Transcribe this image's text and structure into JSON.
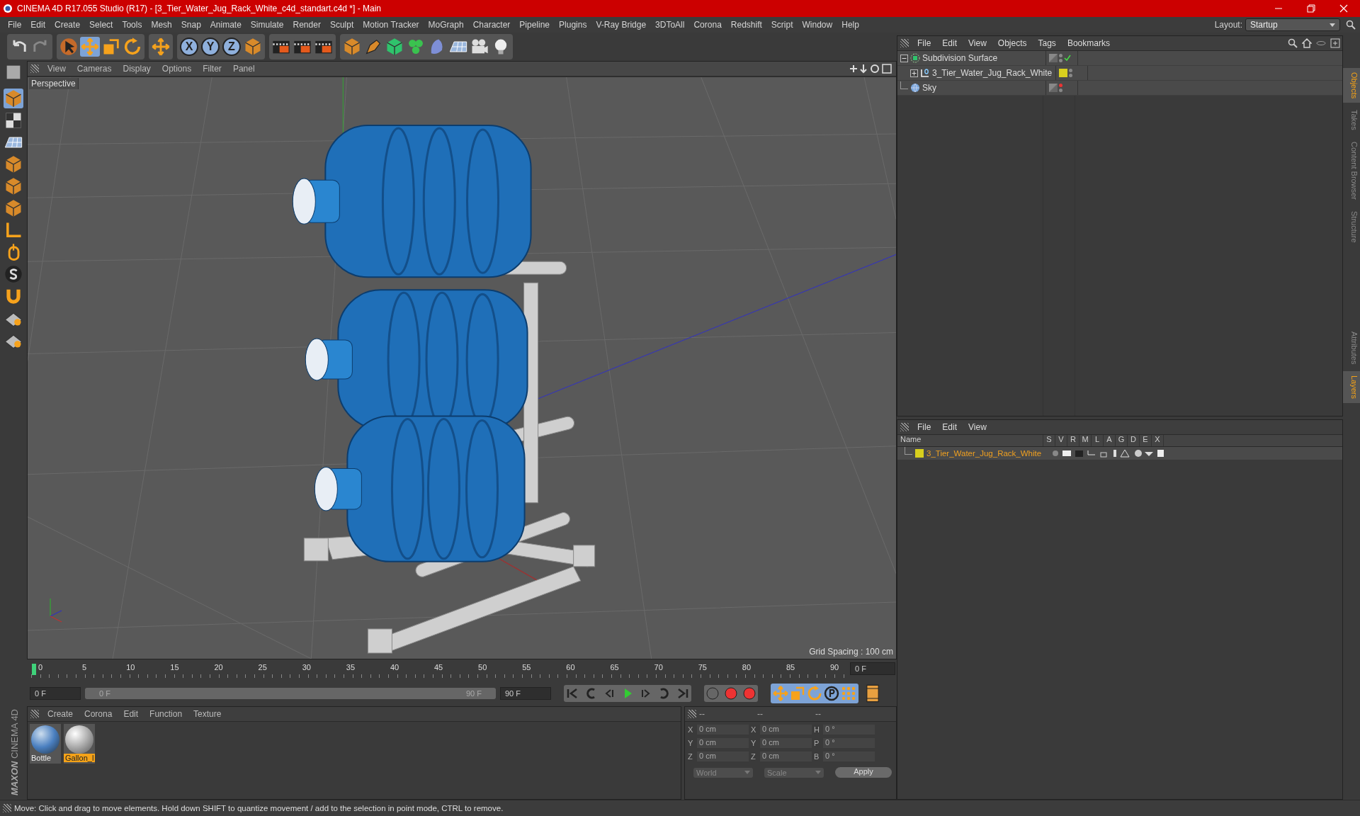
{
  "window": {
    "title": "CINEMA 4D R17.055 Studio (R17) - [3_Tier_Water_Jug_Rack_White_c4d_standart.c4d *] - Main"
  },
  "menu": [
    "File",
    "Edit",
    "Create",
    "Select",
    "Tools",
    "Mesh",
    "Snap",
    "Animate",
    "Simulate",
    "Render",
    "Sculpt",
    "Motion Tracker",
    "MoGraph",
    "Character",
    "Pipeline",
    "Plugins",
    "V-Ray Bridge",
    "3DToAll",
    "Corona",
    "Redshift",
    "Script",
    "Window",
    "Help"
  ],
  "layout": {
    "label": "Layout:",
    "value": "Startup"
  },
  "toolbar": {
    "axis_buttons": [
      "X",
      "Y",
      "Z"
    ]
  },
  "viewport": {
    "menu": [
      "View",
      "Cameras",
      "Display",
      "Options",
      "Filter",
      "Panel"
    ],
    "camera": "Perspective",
    "grid_spacing": "Grid Spacing : 100 cm"
  },
  "timeline": {
    "ticks": [
      "0",
      "5",
      "10",
      "15",
      "20",
      "25",
      "30",
      "35",
      "40",
      "45",
      "50",
      "55",
      "60",
      "65",
      "70",
      "75",
      "80",
      "85",
      "90"
    ],
    "level": 0,
    "current_frame": "0 F",
    "start_field": "0 F",
    "range": {
      "start": "0 F",
      "end": "90 F",
      "level": 1
    },
    "end_field": "90 F"
  },
  "materials": {
    "menu": [
      "Create",
      "Corona",
      "Edit",
      "Function",
      "Texture"
    ],
    "items": [
      {
        "name": "Bottle",
        "selected": false
      },
      {
        "name": "Gallon_l",
        "selected": true
      }
    ]
  },
  "coordinates": {
    "headers": [
      "--",
      "--",
      "--"
    ],
    "rows": [
      [
        {
          "label": "X",
          "value": "0 cm"
        },
        {
          "label": "X",
          "value": "0 cm"
        },
        {
          "label": "H",
          "value": "0 °"
        }
      ],
      [
        {
          "label": "Y",
          "value": "0 cm"
        },
        {
          "label": "Y",
          "value": "0 cm"
        },
        {
          "label": "P",
          "value": "0 °"
        }
      ],
      [
        {
          "label": "Z",
          "value": "0 cm"
        },
        {
          "label": "Z",
          "value": "0 cm"
        },
        {
          "label": "B",
          "value": "0 °"
        }
      ]
    ],
    "dropdowns": [
      "World",
      "Scale"
    ],
    "apply": "Apply"
  },
  "logo": {
    "brand": "MAXON",
    "product": "CINEMA 4D"
  },
  "object_manager": {
    "menu": [
      "File",
      "Edit",
      "View",
      "Objects",
      "Tags",
      "Bookmarks"
    ],
    "objects": [
      {
        "name": "Subdivision Surface",
        "kind": "subdivision",
        "expanded": true,
        "checked": true,
        "children": [
          {
            "name": "3_Tier_Water_Jug_Rack_White",
            "kind": "null",
            "expanded": false,
            "checked": false,
            "color": "#d8cf1e"
          }
        ]
      },
      {
        "name": "Sky",
        "kind": "sky",
        "checked": false
      }
    ]
  },
  "layer_manager": {
    "menu": [
      "File",
      "Edit",
      "View"
    ],
    "columns": [
      "Name",
      "S",
      "V",
      "R",
      "M",
      "L",
      "A",
      "G",
      "D",
      "E",
      "X"
    ],
    "layers": [
      {
        "name": "3_Tier_Water_Jug_Rack_White",
        "color": "#d8cf1e"
      }
    ]
  },
  "side_tabs": [
    {
      "label": "Objects",
      "selected": true
    },
    {
      "label": "Takes",
      "selected": false
    },
    {
      "label": "Content Browser",
      "selected": false
    },
    {
      "label": "Structure",
      "selected": false
    }
  ],
  "side_tabs_lower": [
    {
      "label": "Attributes",
      "selected": false
    },
    {
      "label": "Layers",
      "selected": true
    }
  ],
  "status_bar": "Move: Click and drag to move elements. Hold down SHIFT to quantize movement / add to the selection in point mode, CTRL to remove."
}
